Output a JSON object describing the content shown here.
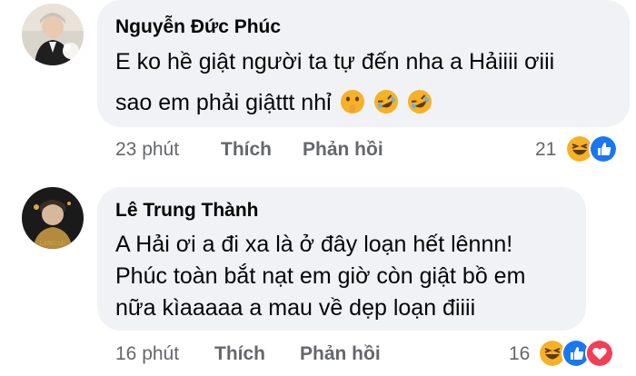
{
  "comments": [
    {
      "author": "Nguyễn Đức Phúc",
      "lines": [
        "E ko hề giật người ta tự đến nha a Hảiiii ơiii",
        "sao em phải giậttt nhỉ"
      ],
      "emojis": [
        "shushing-face-icon",
        "rofl-face-icon",
        "rofl-face-icon"
      ],
      "time": "23 phút",
      "like_label": "Thích",
      "reply_label": "Phản hồi",
      "reaction_count": "21",
      "reactions": [
        "haha-reaction-icon",
        "like-reaction-icon"
      ]
    },
    {
      "author": "Lê Trung Thành",
      "lines": [
        "A Hải ơi a đi xa là ở đây loạn hết lênnn!",
        "Phúc toàn bắt nạt em giờ còn giật bồ em",
        "nữa kìaaaaa a mau về dẹp loạn điiii"
      ],
      "time": "16 phút",
      "like_label": "Thích",
      "reply_label": "Phản hồi",
      "reaction_count": "16",
      "reactions": [
        "haha-reaction-icon",
        "like-reaction-icon",
        "love-reaction-icon"
      ]
    }
  ],
  "colors": {
    "bubble": "#f0f2f5",
    "meta_text": "#65676b",
    "like_blue": "#1877f2",
    "love_red": "#f33e58",
    "haha_yellow": "#f7b125"
  }
}
